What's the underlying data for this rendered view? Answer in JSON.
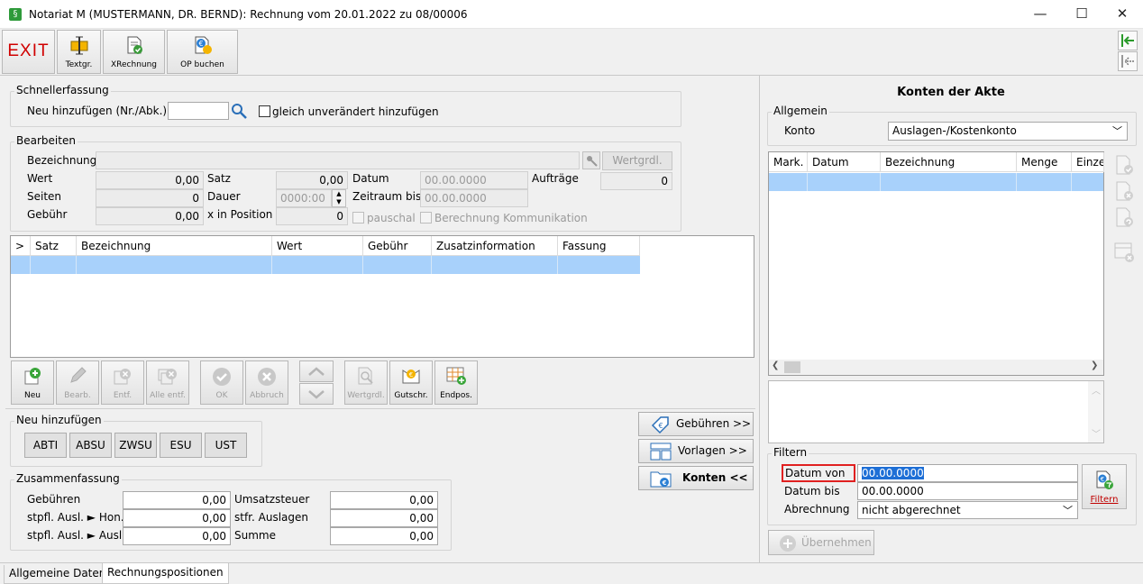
{
  "window": {
    "title": "Notariat M (MUSTERMANN, DR. BERND): Rechnung vom 20.01.2022 zu 08/00006",
    "app_icon": "§",
    "minimize_glyph": "—",
    "maximize_glyph": "☐",
    "close_glyph": "✕"
  },
  "toolbar": {
    "exit_label": "EXIT",
    "textgr_label": "Textgr.",
    "xrechnung_label": "XRechnung",
    "op_buchen_label": "OP buchen"
  },
  "schnellerfassung": {
    "legend": "Schnellerfassung",
    "neu_label": "Neu hinzufügen (Nr./Abk.)",
    "neu_value": "",
    "gleich_label": "gleich unverändert hinzufügen"
  },
  "bearbeiten": {
    "legend": "Bearbeiten",
    "bezeichnung_label": "Bezeichnung",
    "bezeichnung_value": "",
    "wertgrdl_label": "Wertgrdl.",
    "wert_label": "Wert",
    "wert_value": "0,00",
    "satz_label": "Satz",
    "satz_value": "0,00",
    "datum_label": "Datum",
    "datum_value": "00.00.0000",
    "auftraege_label": "Aufträge",
    "auftraege_value": "0",
    "seiten_label": "Seiten",
    "seiten_value": "0",
    "dauer_label": "Dauer",
    "dauer_value": "0000:00",
    "zeitraum_label": "Zeitraum bis",
    "zeitraum_value": "00.00.0000",
    "gebuehr_label": "Gebühr",
    "gebuehr_value": "0,00",
    "xpos_label": "x in Position",
    "xpos_value": "0",
    "pauschal_label": "pauschal",
    "berechnung_label": "Berechnung Kommunikation"
  },
  "positions_table": {
    "columns": [
      ">",
      "Satz",
      "Bezeichnung",
      "Wert",
      "Gebühr",
      "Zusatzinformation",
      "Fassung"
    ]
  },
  "action_buttons": {
    "neu": "Neu",
    "bearb": "Bearb.",
    "entf": "Entf.",
    "alle_entf": "Alle entf.",
    "ok": "OK",
    "abbruch": "Abbruch",
    "wertgrdl": "Wertgrdl.",
    "gutschr": "Gutschr.",
    "endpos": "Endpos."
  },
  "neu_hinzufuegen": {
    "legend": "Neu hinzufügen",
    "buttons": [
      "ABTI",
      "ABSU",
      "ZWSU",
      "ESU",
      "UST"
    ]
  },
  "side_buttons": {
    "gebuehren": "Gebühren >>",
    "vorlagen": "Vorlagen >>",
    "konten": "Konten <<"
  },
  "zusammenfassung": {
    "legend": "Zusammenfassung",
    "gebuehren_label": "Gebühren",
    "gebuehren_value": "0,00",
    "stpfl_hon_label": "stpfl. Ausl. ► Hon.",
    "stpfl_hon_value": "0,00",
    "stpfl_ausl_label": "stpfl. Ausl. ► Ausl.",
    "stpfl_ausl_value": "0,00",
    "ust_label": "Umsatzsteuer",
    "ust_value": "0,00",
    "stfr_label": "stfr. Auslagen",
    "stfr_value": "0,00",
    "summe_label": "Summe",
    "summe_value": "0,00"
  },
  "tabs": [
    "Allgemeine Daten",
    "Rechnungspositionen"
  ],
  "konten": {
    "title": "Konten der Akte",
    "allgemein_legend": "Allgemein",
    "konto_label": "Konto",
    "konto_value": "Auslagen-/Kostenkonto",
    "columns": [
      "Mark.",
      "Datum",
      "Bezeichnung",
      "Menge",
      "Einze"
    ],
    "filter_legend": "Filtern",
    "datum_von_label": "Datum von",
    "datum_von_value": "00.00.0000",
    "datum_bis_label": "Datum bis",
    "datum_bis_value": "00.00.0000",
    "abrechnung_label": "Abrechnung",
    "abrechnung_value": "nicht abgerechnet",
    "filtern_button": "Filtern",
    "uebernehmen_button": "Übernehmen"
  },
  "colors": {
    "selection": "#a8d1fb",
    "exit_red": "#d00000",
    "highlight_border": "#e02020",
    "focus_fill": "#1e6fd6"
  }
}
